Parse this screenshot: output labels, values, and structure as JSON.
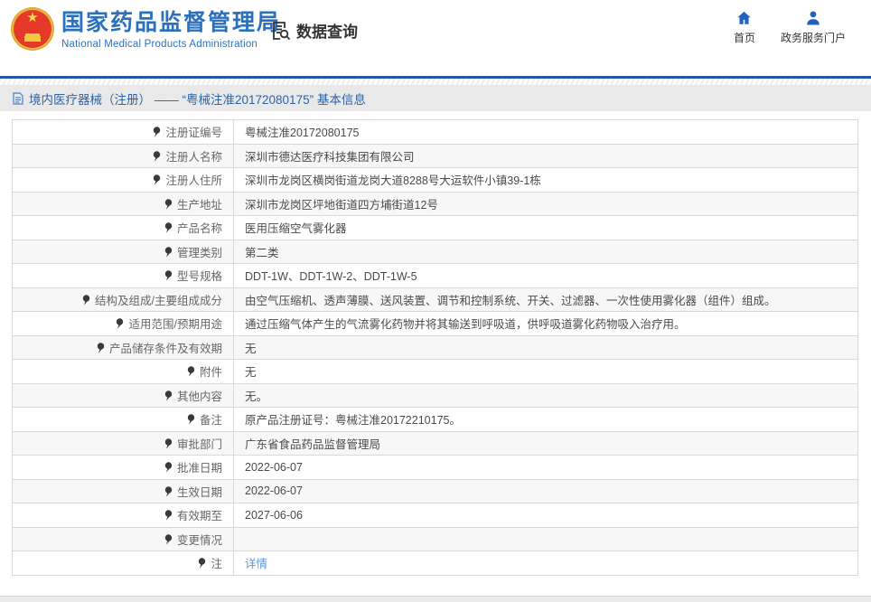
{
  "header": {
    "brand": {
      "title": "国家药品监督管理局",
      "subtitle": "National Medical Products Administration",
      "emblem_icon": "china-national-emblem-icon"
    },
    "section": {
      "label": "数据查询",
      "icon": "document-search-icon"
    },
    "nav": [
      {
        "label": "首页",
        "icon": "home-icon"
      },
      {
        "label": "政务服务门户",
        "icon": "user-icon"
      }
    ]
  },
  "page": {
    "title": "境内医疗器械（注册） —— “粤械注准20172080175” 基本信息",
    "title_icon": "document-icon"
  },
  "table": {
    "rows": [
      {
        "label": "注册证编号",
        "value": "粤械注准20172080175"
      },
      {
        "label": "注册人名称",
        "value": "深圳市德达医疗科技集团有限公司"
      },
      {
        "label": "注册人住所",
        "value": "深圳市龙岗区横岗街道龙岗大道8288号大运软件小镇39-1栋"
      },
      {
        "label": "生产地址",
        "value": "深圳市龙岗区坪地街道四方埔街道12号"
      },
      {
        "label": "产品名称",
        "value": "医用压缩空气雾化器"
      },
      {
        "label": "管理类别",
        "value": "第二类"
      },
      {
        "label": "型号规格",
        "value": "DDT-1W、DDT-1W-2、DDT-1W-5"
      },
      {
        "label": "结构及组成/主要组成成分",
        "value": "由空气压缩机、透声薄膜、送风装置、调节和控制系统、开关、过滤器、一次性使用雾化器（组件）组成。"
      },
      {
        "label": "适用范围/预期用途",
        "value": "通过压缩气体产生的气流雾化药物并将其输送到呼吸道，供呼吸道雾化药物吸入治疗用。"
      },
      {
        "label": "产品储存条件及有效期",
        "value": "无"
      },
      {
        "label": "附件",
        "value": "无"
      },
      {
        "label": "其他内容",
        "value": "无。"
      },
      {
        "label": "备注",
        "value": "原产品注册证号：粤械注准20172210175。"
      },
      {
        "label": "审批部门",
        "value": "广东省食品药品监督管理局"
      },
      {
        "label": "批准日期",
        "value": "2022-06-07"
      },
      {
        "label": "生效日期",
        "value": "2022-06-07"
      },
      {
        "label": "有效期至",
        "value": "2027-06-06"
      },
      {
        "label": "变更情况",
        "value": ""
      },
      {
        "label": "注",
        "value": "详情",
        "label_icon": "pin-icon",
        "value_is_link": true
      }
    ]
  },
  "colors": {
    "brand_blue": "#2a70bd",
    "divider_blue": "#2456a5",
    "nav_icon_blue": "#2062c0",
    "title_text_blue": "#2d64a5",
    "link_blue": "#5596e0",
    "band_gray": "#e9e9e9",
    "row_alt_gray": "#f7f7f7",
    "border_gray": "#d9d9d9"
  }
}
